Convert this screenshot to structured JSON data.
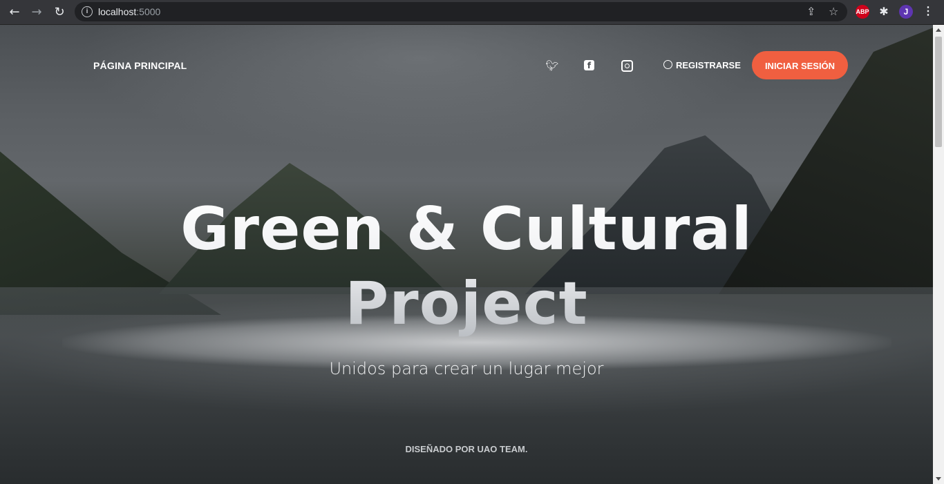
{
  "browser": {
    "url_host": "localhost",
    "url_port": ":5000",
    "icons": {
      "back": "arrow-left-icon",
      "forward": "arrow-right-icon",
      "reload": "reload-icon",
      "info": "info-icon",
      "share": "share-icon",
      "bookmark": "star-icon",
      "extensions": "puzzle-icon",
      "menu": "kebab-menu-icon"
    },
    "extension_abp_label": "ABP",
    "profile_initial": "J"
  },
  "site_nav": {
    "brand": "PÁGINA PRINCIPAL",
    "social": [
      "twitter",
      "facebook",
      "instagram"
    ],
    "register_label": "REGISTRARSE",
    "login_label": "INICIAR SESIÓN"
  },
  "hero": {
    "title_line1": "Green & Cultural",
    "title_line2": "Project",
    "subtitle": "Unidos para crear un lugar mejor"
  },
  "footer": {
    "credits": "DISEÑADO POR UAO TEAM."
  },
  "colors": {
    "accent": "#f05f40",
    "chrome_bg": "#35363a",
    "omnibox_bg": "#202124"
  }
}
